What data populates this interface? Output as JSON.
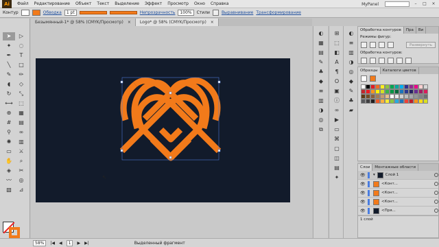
{
  "app": {
    "logo": "Ai",
    "workspace": "MyPanel"
  },
  "menu": [
    "Файл",
    "Редактирование",
    "Объект",
    "Текст",
    "Выделение",
    "Эффект",
    "Просмотр",
    "Окно",
    "Справка"
  ],
  "control": {
    "label": "Контур",
    "stroke_link": "Обводка",
    "stroke_weight": "1 pt",
    "opacity_link": "Непрозрачность",
    "opacity_value": "100%",
    "styles_label": "Стили",
    "align_link": "Выравнивание",
    "transform_link": "Трансформирование",
    "stroke_color": "#f27a1a"
  },
  "tabs": [
    {
      "label": "Безымянный-1* @ 58% (CMYK/Просмотр)",
      "close": "×"
    },
    {
      "label": "Logo* @ 58% (CMYK/Просмотр)",
      "close": "×"
    }
  ],
  "artwork": {
    "background": "#121b2b",
    "stroke_color": "#f27a1a",
    "path_color": "#4b78d4"
  },
  "status": {
    "zoom": "58%",
    "page": "1",
    "state": "Выделенный фрагмент"
  },
  "pathfinder": {
    "tabs": [
      "Обработка контуров",
      "Пра",
      "Ви"
    ],
    "shape_modes": "Режимы фигур:",
    "expand": "Развернуть",
    "pathfinders": "Обработка контуров:"
  },
  "swatches": {
    "tabs": [
      "Образцы",
      "Каталоги цветов"
    ],
    "colors": [
      "#ffffff",
      "#000000",
      "#e21b23",
      "#f36c21",
      "#fcee21",
      "#8dc63f",
      "#00a650",
      "#00a99d",
      "#00aeef",
      "#2e3192",
      "#92278f",
      "#ec008c",
      "#f9d0d0",
      "#d6d6d6",
      "#c1272d",
      "#ed1c24",
      "#f7941d",
      "#fff200",
      "#d7df23",
      "#39b54a",
      "#009444",
      "#006838",
      "#1b75bb",
      "#2b3990",
      "#262262",
      "#662d91",
      "#9e1f63",
      "#da1c5c",
      "#603913",
      "#754c24",
      "#8b5e3c",
      "#a67c52",
      "#c69c6d",
      "#e6be8a",
      "#ffffff",
      "#e6e7e8",
      "#d1d3d4",
      "#bcbec0",
      "#a7a9ac",
      "#939598",
      "#808285",
      "#6d6e71",
      "#58595b",
      "#414042",
      "#231f20",
      "#f15a29",
      "#fbb040",
      "#f9ed32",
      "#8dc63f",
      "#27aae1",
      "#1c75bc",
      "#ef4136",
      "#be1e2d",
      "#f7941d",
      "#ffde17",
      "#d9e021"
    ]
  },
  "layers": {
    "tabs": [
      "Слои",
      "Монтажные области"
    ],
    "rows": [
      {
        "name": "Слой 1",
        "parent": true
      },
      {
        "name": "<Конт...",
        "parent": false
      },
      {
        "name": "<Конт...",
        "parent": false
      },
      {
        "name": "<Конт...",
        "parent": false
      },
      {
        "name": "<Пря...",
        "parent": false
      }
    ],
    "footer": "1 слой"
  }
}
